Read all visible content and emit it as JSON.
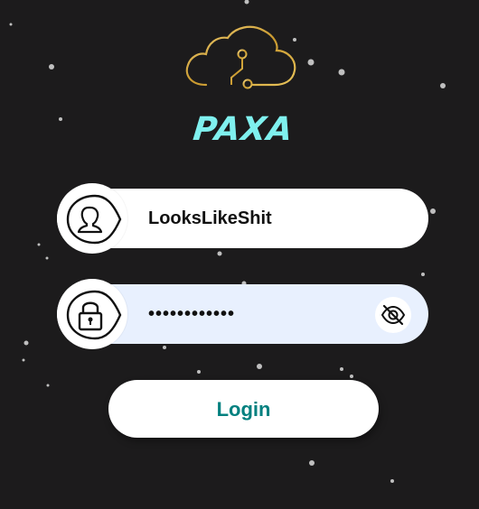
{
  "brand": {
    "name": "PAXA",
    "logo_icon": "cloud-circuit-icon",
    "brand_color": "#7ff0ee",
    "logo_color": "#d4a93a"
  },
  "login_form": {
    "username": {
      "value": "LooksLikeShit",
      "icon": "user-icon"
    },
    "password": {
      "value": "••••••••••••",
      "icon": "lock-icon",
      "toggle_icon": "eye-slash-icon"
    },
    "submit_label": "Login",
    "accent_color": "#00807f"
  },
  "background": {
    "color": "#1c1b1c",
    "decoration": "starfield"
  }
}
